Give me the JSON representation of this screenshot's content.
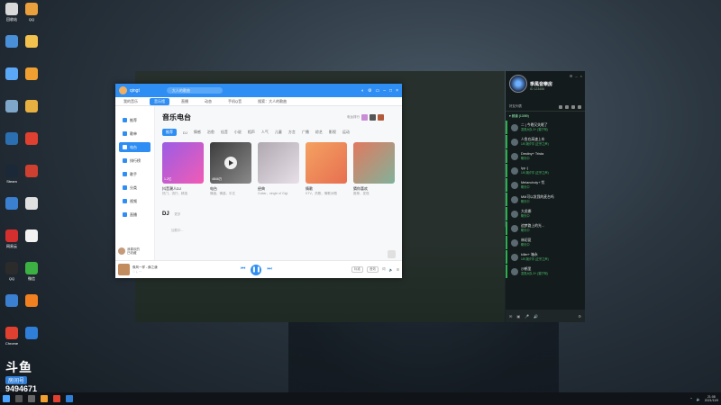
{
  "desktop": {
    "icons": [
      {
        "label": "回收站",
        "color": "#d9d9d9"
      },
      {
        "label": "QQ",
        "color": "#eaa03c"
      },
      {
        "label": "",
        "color": "#4a90d9"
      },
      {
        "label": "",
        "color": "#f2c14e"
      },
      {
        "label": "",
        "color": "#5aa8f6"
      },
      {
        "label": "",
        "color": "#f0a030"
      },
      {
        "label": "",
        "color": "#7fa7c9"
      },
      {
        "label": "",
        "color": "#e8b040"
      },
      {
        "label": "",
        "color": "#2b6fb0"
      },
      {
        "label": "",
        "color": "#e04030"
      },
      {
        "label": "Steam",
        "color": "#1b2838"
      },
      {
        "label": "",
        "color": "#d04030"
      },
      {
        "label": "",
        "color": "#3a7fd0"
      },
      {
        "label": "",
        "color": "#e0e0e0"
      },
      {
        "label": "网易云",
        "color": "#d32f2f"
      },
      {
        "label": "",
        "color": "#f2f2f2"
      },
      {
        "label": "QQ",
        "color": "#2b2b2b"
      },
      {
        "label": "微信",
        "color": "#3cb043"
      },
      {
        "label": "",
        "color": "#3a7fd0"
      },
      {
        "label": "",
        "color": "#f08020"
      },
      {
        "label": "Chrome",
        "color": "#e04030"
      },
      {
        "label": "",
        "color": "#2f7ed8"
      }
    ],
    "watermark": {
      "logo": "斗鱼",
      "sub": "房间号",
      "room_id": "9494671"
    }
  },
  "music_app": {
    "user": "qingt",
    "search_placeholder": "大人的歌曲",
    "nav_tabs": [
      "我的音乐",
      "音乐馆",
      "直播",
      "动态",
      "手机Q音",
      "搜索：大人的歌曲"
    ],
    "nav_active": 1,
    "sidebar": {
      "items": [
        "推荐",
        "歌单",
        "电台",
        "排行榜",
        "歌手",
        "分类",
        "视频",
        "直播"
      ],
      "active": 2,
      "now_playing_label": "我喜欢的",
      "now_playing_sub": "已收藏"
    },
    "page_title": "音乐电台",
    "title_action": "电台排行",
    "categories": [
      "推荐",
      "DJ",
      "情感",
      "治愈",
      "佳音",
      "小说",
      "相声",
      "人气",
      "儿童",
      "方言",
      "广播",
      "综艺",
      "影视",
      "运动"
    ],
    "category_active": 0,
    "cards": [
      {
        "name": "抖音潮人DJ",
        "desc": "热门，流行，精选",
        "count": "1.2亿",
        "color1": "#9b5de5",
        "color2": "#f15bb5",
        "play": false
      },
      {
        "name": "电台",
        "desc": "情绪，情感，中文",
        "count": "4846万",
        "color1": "#3d3d3d",
        "color2": "#8a8a8a",
        "play": true
      },
      {
        "name": "经典",
        "desc": "Guitar，single of Gigi",
        "count": "",
        "color1": "#b0a8b0",
        "color2": "#e8e0e8",
        "play": false
      },
      {
        "name": "情歌",
        "desc": "KTV，热歌，情歌对唱",
        "count": "",
        "color1": "#f4a261",
        "color2": "#e76f51",
        "play": false
      },
      {
        "name": "猜你喜欢",
        "desc": "推荐，发现",
        "count": "",
        "color1": "#e07a5f",
        "color2": "#81b29a",
        "play": false
      }
    ],
    "dj_section": {
      "title": "DJ",
      "sub": "更多"
    },
    "loading_text": "加载中...",
    "player": {
      "song": "像风一样 - 薛之谦",
      "sub": "",
      "quality": "标准",
      "effect": "音效",
      "lyric": "词"
    }
  },
  "chat": {
    "title": "季風音樂房",
    "subtitle": "ID 123456",
    "tab_label": "好友列表",
    "group_label": "▾ 频道 (13/89)",
    "members": [
      {
        "name": "二 | 今晚又失眠了",
        "status": "发现大队 5+ (猫宁阿)"
      },
      {
        "name": "人鱼在高速上车",
        "status": "1/8 潮汐宇 (正宗之声)"
      },
      {
        "name": "Destiny+ Trista",
        "status": "聊天中"
      },
      {
        "name": "lyp :)",
        "status": "1/8 潮汐宇 (正宗之声)"
      },
      {
        "name": "Melancholy+ 忧",
        "status": "聊天中"
      },
      {
        "name": "MM可以发我的麦台吗",
        "status": "聊天中"
      },
      {
        "name": "大虎娜",
        "status": "聊天中"
      },
      {
        "name": "追梦路上的光...",
        "status": "聊天中"
      },
      {
        "name": "林初夏",
        "status": "聊天中"
      },
      {
        "name": "killer+ 箱永",
        "status": "1/8 潮汐宇 (正宗之声)"
      },
      {
        "name": "沙鹤里",
        "status": "发现大队 5+ (猫宁阿)"
      }
    ]
  },
  "taskbar": {
    "time": "21:08",
    "date": "2021/11/9"
  }
}
